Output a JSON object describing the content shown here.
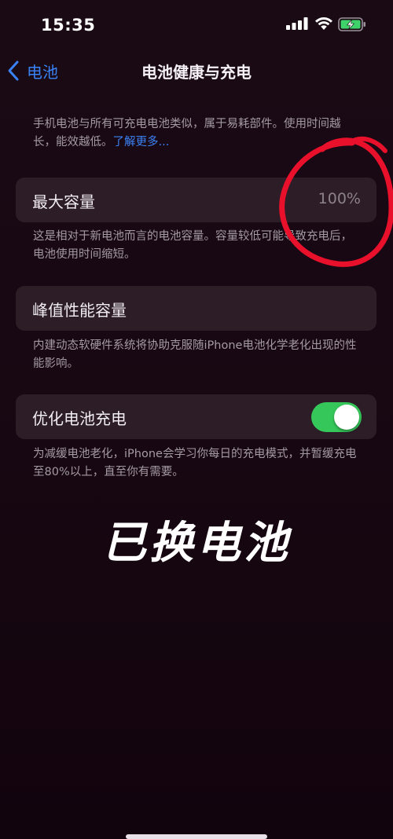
{
  "status_bar": {
    "time": "15:35",
    "signal_icon": "cellular-signal-icon",
    "wifi_icon": "wifi-icon",
    "battery_icon": "battery-charging-icon",
    "battery_color": "#3fd16a"
  },
  "nav": {
    "back_label": "电池",
    "title": "电池健康与充电"
  },
  "intro": {
    "text": "手机电池与所有可充电电池类似，属于易耗部件。使用时间越长，能效越低。",
    "link": "了解更多..."
  },
  "max_capacity": {
    "label": "最大容量",
    "value": "100%",
    "footnote": "这是相对于新电池而言的电池容量。容量较低可能导致充电后，电池使用时间缩短。"
  },
  "peak_performance": {
    "label": "峰值性能容量",
    "footnote": "内建动态软硬件系统将协助克服随iPhone电池化学老化出现的性能影响。"
  },
  "optimized_charging": {
    "label": "优化电池充电",
    "enabled": true,
    "footnote": "为减缓电池老化，iPhone会学习你每日的充电模式，并暂缓充电至80%以上，直至你有需要。"
  },
  "overlay_caption": "已换电池",
  "colors": {
    "accent": "#3a82f7",
    "toggle_on": "#35c759",
    "annotation": "#e8102a"
  }
}
